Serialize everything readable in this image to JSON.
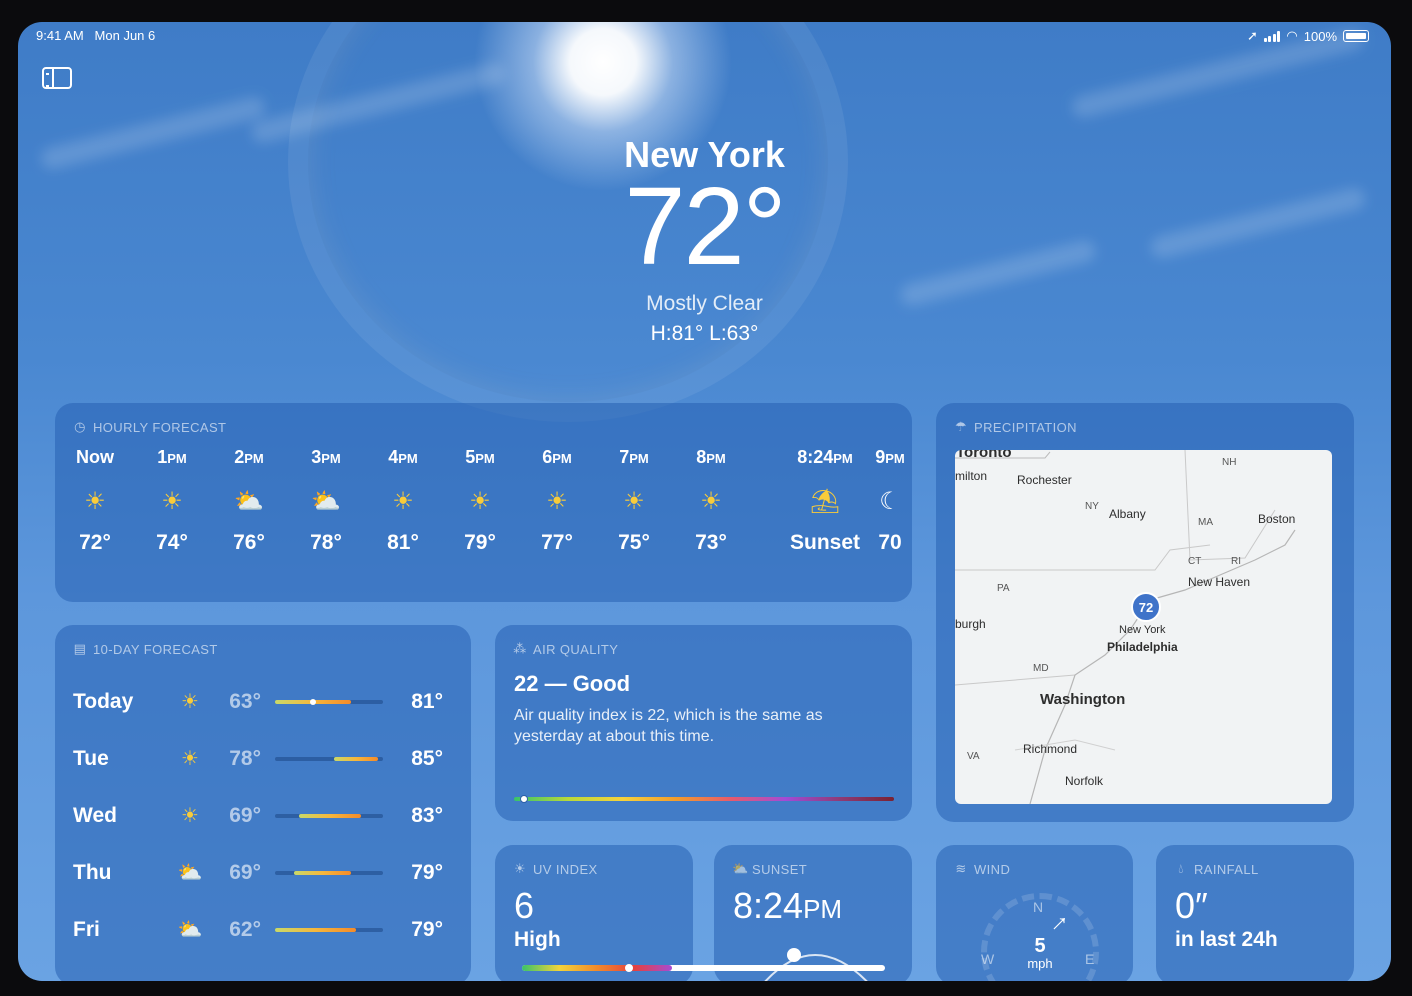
{
  "status": {
    "time": "9:41 AM",
    "date": "Mon Jun 6",
    "battery": "100%"
  },
  "location": {
    "city": "New York",
    "temp": "72°",
    "condition": "Mostly Clear",
    "hilo": "H:81°  L:63°"
  },
  "hourly": {
    "header": "HOURLY FORECAST",
    "items": [
      {
        "time": "Now",
        "suffix": "",
        "icon": "sun",
        "temp": "72°"
      },
      {
        "time": "1",
        "suffix": "PM",
        "icon": "sun",
        "temp": "74°"
      },
      {
        "time": "2",
        "suffix": "PM",
        "icon": "partly-cloudy",
        "temp": "76°"
      },
      {
        "time": "3",
        "suffix": "PM",
        "icon": "partly-cloudy",
        "temp": "78°"
      },
      {
        "time": "4",
        "suffix": "PM",
        "icon": "sun",
        "temp": "81°"
      },
      {
        "time": "5",
        "suffix": "PM",
        "icon": "sun",
        "temp": "79°"
      },
      {
        "time": "6",
        "suffix": "PM",
        "icon": "sun",
        "temp": "77°"
      },
      {
        "time": "7",
        "suffix": "PM",
        "icon": "sun",
        "temp": "75°"
      },
      {
        "time": "8",
        "suffix": "PM",
        "icon": "sun",
        "temp": "73°"
      },
      {
        "time": "8:24",
        "suffix": "PM",
        "icon": "sunset",
        "temp": "Sunset"
      },
      {
        "time": "9",
        "suffix": "PM",
        "icon": "moon",
        "temp": "70"
      }
    ]
  },
  "tenday": {
    "header": "10-DAY FORECAST",
    "days": [
      {
        "name": "Today",
        "icon": "sun",
        "low": "63°",
        "high": "81°"
      },
      {
        "name": "Tue",
        "icon": "sun",
        "low": "78°",
        "high": "85°"
      },
      {
        "name": "Wed",
        "icon": "sun",
        "low": "69°",
        "high": "83°"
      },
      {
        "name": "Thu",
        "icon": "partly-cloudy",
        "low": "69°",
        "high": "79°"
      },
      {
        "name": "Fri",
        "icon": "partly-cloudy",
        "low": "62°",
        "high": "79°"
      }
    ]
  },
  "air_quality": {
    "header": "AIR QUALITY",
    "value": "22 — Good",
    "description": "Air quality index is 22, which is the same as yesterday at about this time."
  },
  "precipitation": {
    "header": "PRECIPITATION",
    "pin": "72",
    "labels": {
      "toronto": "Toronto",
      "hamilton": "milton",
      "rochester": "Rochester",
      "albany": "Albany",
      "boston": "Boston",
      "newhaven": "New Haven",
      "pittsburgh": "burgh",
      "newyork": "New York",
      "philadelphia": "Philadelphia",
      "washington": "Washington",
      "richmond": "Richmond",
      "norfolk": "Norfolk",
      "nh": "NH",
      "ny": "NY",
      "ma": "MA",
      "ct": "CT",
      "ri": "RI",
      "pa": "PA",
      "md": "MD",
      "va": "VA"
    }
  },
  "uv": {
    "header": "UV INDEX",
    "value": "6",
    "level": "High"
  },
  "sunset": {
    "header": "SUNSET",
    "time": "8:24",
    "suffix": "PM"
  },
  "wind": {
    "header": "WIND",
    "speed": "5",
    "unit": "mph",
    "n": "N",
    "e": "E",
    "w": "W"
  },
  "rainfall": {
    "header": "RAINFALL",
    "value": "0″",
    "sub": "in last 24h"
  }
}
